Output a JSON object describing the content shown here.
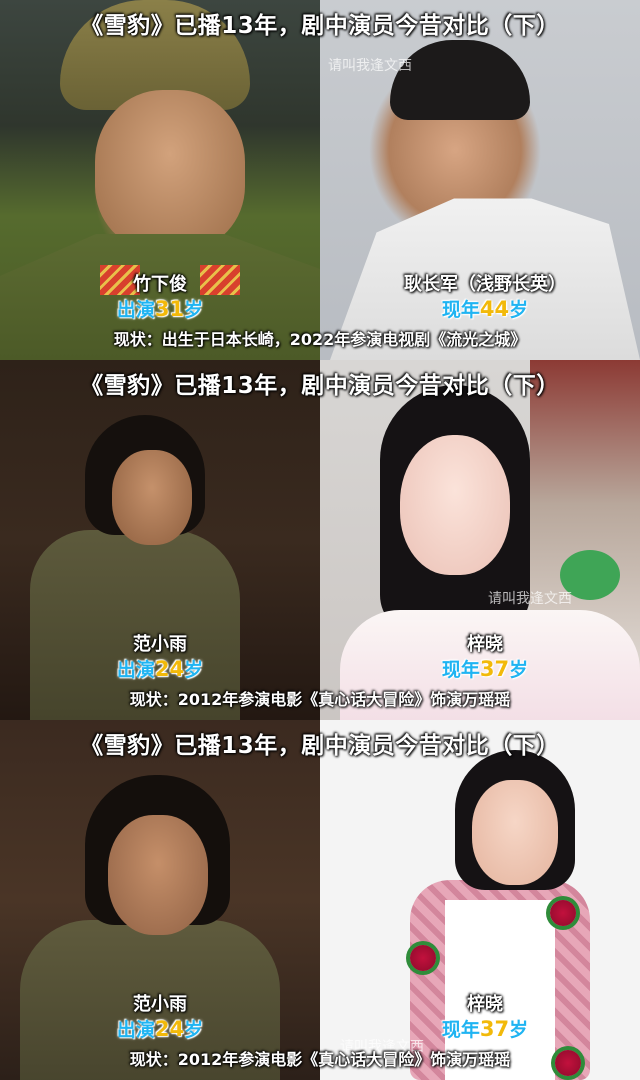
{
  "panels": [
    {
      "title": "《雪豹》已播13年，剧中演员今昔对比（下）",
      "watermark": "请叫我逢文西",
      "left": {
        "name": "竹下俊",
        "age_prefix": "出演",
        "age_num": "31",
        "age_suffix": "岁"
      },
      "right": {
        "name": "耿长军（浅野长英）",
        "age_prefix": "现年",
        "age_num": "44",
        "age_suffix": "岁"
      },
      "status": "现状：出生于日本长崎，2022年参演电视剧《流光之城》"
    },
    {
      "title": "《雪豹》已播13年，剧中演员今昔对比（下）",
      "watermark": "请叫我逢文西",
      "left": {
        "name": "范小雨",
        "age_prefix": "出演",
        "age_num": "24",
        "age_suffix": "岁"
      },
      "right": {
        "name": "梓晓",
        "age_prefix": "现年",
        "age_num": "37",
        "age_suffix": "岁"
      },
      "status": "现状：2012年参演电影《真心话大冒险》饰演万瑶瑶"
    },
    {
      "title": "《雪豹》已播13年，剧中演员今昔对比（下）",
      "watermark": "请叫我逢文西",
      "left": {
        "name": "范小雨",
        "age_prefix": "出演",
        "age_num": "24",
        "age_suffix": "岁"
      },
      "right": {
        "name": "梓晓",
        "age_prefix": "现年",
        "age_num": "37",
        "age_suffix": "岁"
      },
      "status": "现状：2012年参演电影《真心话大冒险》饰演万瑶瑶"
    }
  ],
  "colors": {
    "age_label": "#1fb4f2",
    "age_number": "#f2b90a",
    "caption_text": "#ffffff"
  }
}
